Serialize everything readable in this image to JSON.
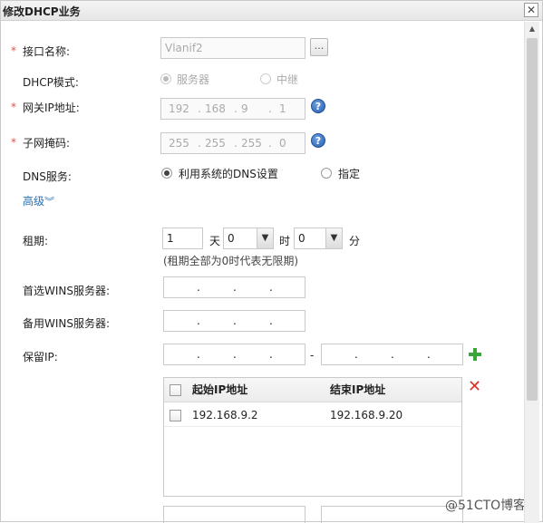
{
  "dialog": {
    "title": "修改DHCP业务"
  },
  "form": {
    "interface_name": {
      "label": "接口名称:",
      "value": "Vlanif2",
      "browse": "..."
    },
    "dhcp_mode": {
      "label": "DHCP模式:",
      "options": [
        "服务器",
        "中继"
      ],
      "selected": "服务器"
    },
    "gateway_ip": {
      "label": "网关IP地址:",
      "octets": [
        "192",
        "168",
        "9",
        "1"
      ]
    },
    "subnet_mask": {
      "label": "子网掩码:",
      "octets": [
        "255",
        "255",
        "255",
        "0"
      ]
    },
    "dns": {
      "label": "DNS服务:",
      "options": [
        "利用系统的DNS设置",
        "指定"
      ],
      "selected": "利用系统的DNS设置"
    },
    "advanced": {
      "label": "高级"
    },
    "lease": {
      "label": "租期:",
      "days": "1",
      "days_unit": "天",
      "hours": "0",
      "hours_unit": "时",
      "minutes": "0",
      "minutes_unit": "分",
      "hint": "(租期全部为0时代表无限期)"
    },
    "primary_wins": {
      "label": "首选WINS服务器:"
    },
    "backup_wins": {
      "label": "备用WINS服务器:"
    },
    "reserved_ip": {
      "label": "保留IP:",
      "separator": "-"
    }
  },
  "reserved_table": {
    "columns": [
      "起始IP地址",
      "结束IP地址"
    ],
    "rows": [
      {
        "start": "192.168.9.2",
        "end": "192.168.9.20"
      }
    ]
  },
  "watermark": "@51CTO博客",
  "colors": {
    "required": "#d9534f",
    "link": "#2a6fb0",
    "add": "#3aa63a",
    "delete": "#d9332a",
    "help": "#2a5fb0"
  }
}
